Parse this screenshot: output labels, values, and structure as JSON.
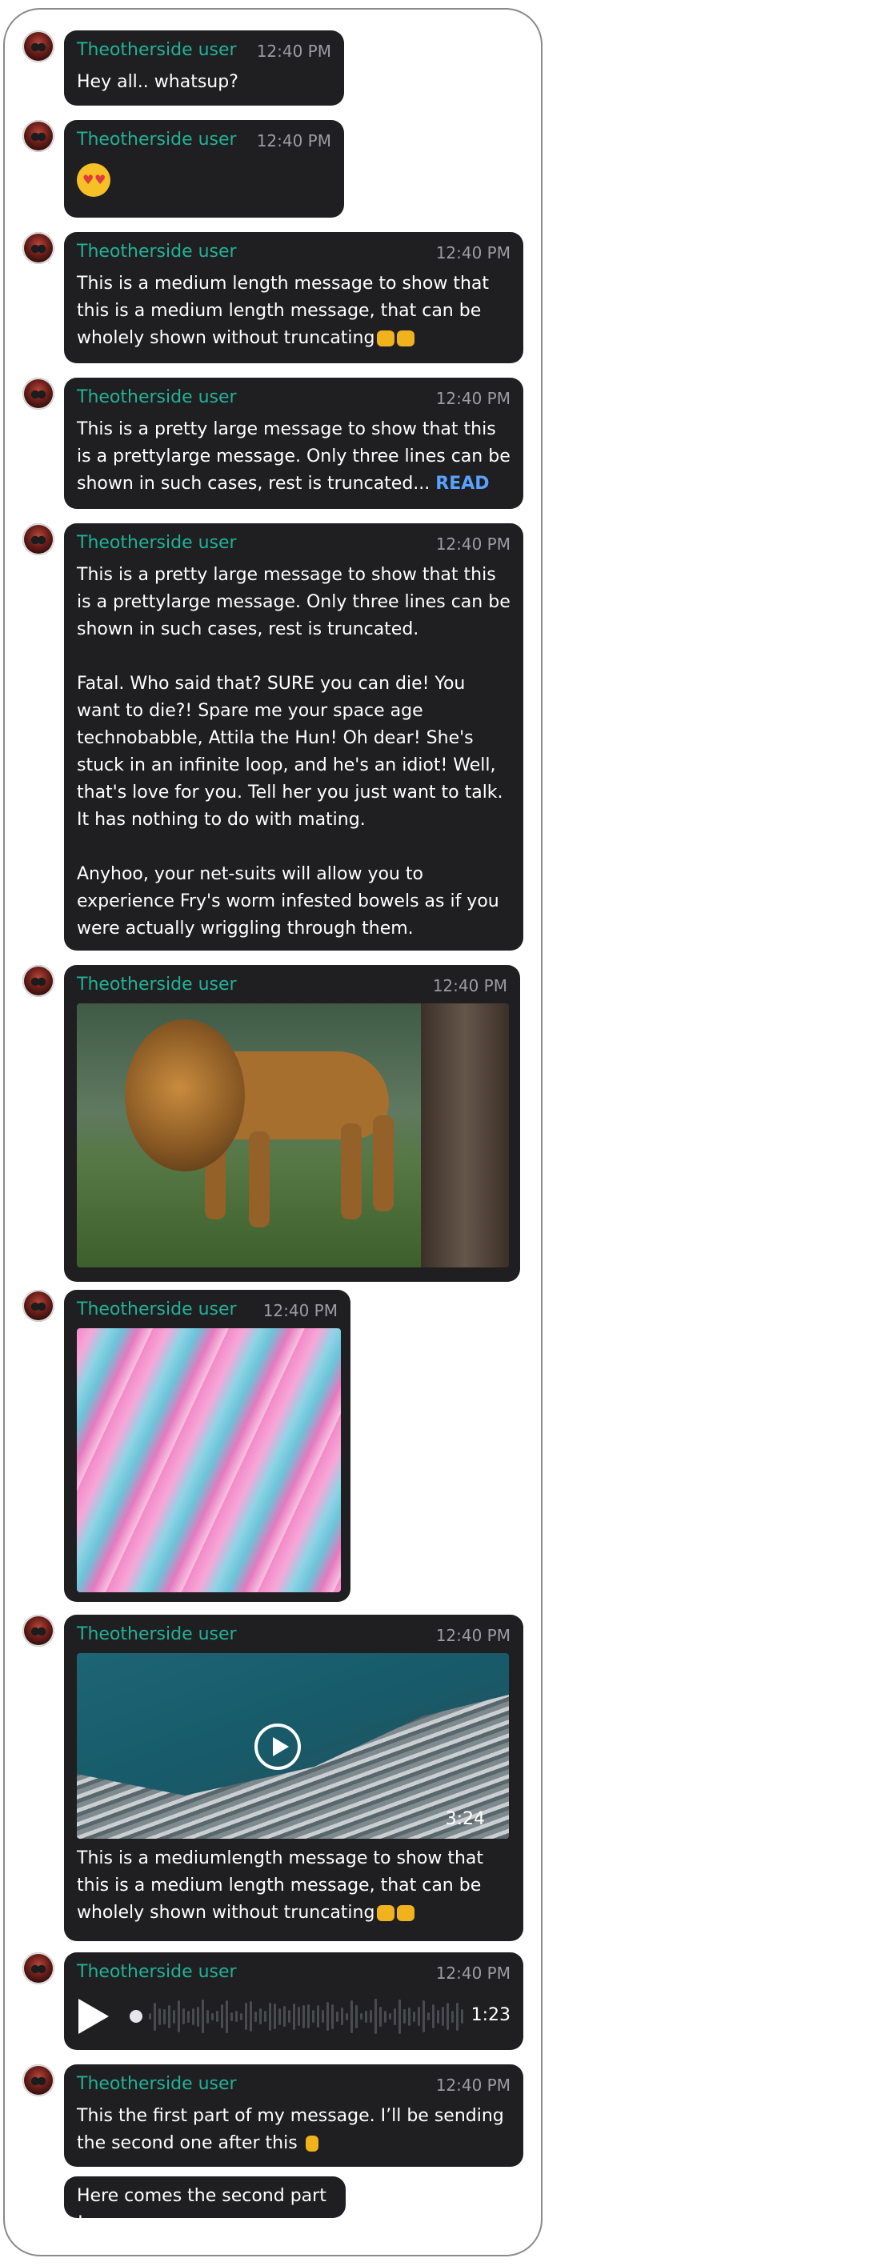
{
  "messages": [
    {
      "user": "Theotherside user",
      "time": "12:40 PM",
      "text": "Hey all.. whatsup?"
    },
    {
      "user": "Theotherside user",
      "time": "12:40 PM",
      "emoji": "heart-eyes-emoji"
    },
    {
      "user": "Theotherside user",
      "time": "12:40 PM",
      "text": "This is a medium length message to show that this is a medium length message, that can be wholely shown without truncating"
    },
    {
      "user": "Theotherside user",
      "time": "12:40 PM",
      "text": "This is a pretty large message to show that this is a prettylarge message. Only three lines can be shown in such cases, rest is truncated...",
      "read_more": "READ"
    },
    {
      "user": "Theotherside user",
      "time": "12:40 PM",
      "text_p1": "This is a pretty large message to show that this is a prettylarge message. Only three lines can be shown in such cases, rest is truncated.",
      "text_p2": "Fatal. Who said that? SURE you can die! You want to die?! Spare me your space age technobabble, Attila the Hun! Oh dear! She's stuck in an infinite loop, and he's an idiot! Well, that's love for you. Tell her you just want to talk. It has nothing to do with mating.",
      "text_p3": "Anyhoo, your net-suits will allow you to experience Fry's worm infested bowels as if you were actually wriggling through them."
    },
    {
      "user": "Theotherside user",
      "time": "12:40 PM",
      "image": "lion-photo"
    },
    {
      "user": "Theotherside user",
      "time": "12:40 PM",
      "image": "abstract-paint-photo"
    },
    {
      "user": "Theotherside user",
      "time": "12:40 PM",
      "video_duration": "3:24",
      "text": "This is a mediumlength message to show that this is a medium length message, that can be wholely shown without truncating"
    },
    {
      "user": "Theotherside user",
      "time": "12:40 PM",
      "audio_duration": "1:23"
    },
    {
      "user": "Theotherside user",
      "time": "12:40 PM",
      "text": "This the first part of my message. I’ll be sending the second one after this",
      "followup": "Here comes the second part !"
    }
  ],
  "colors": {
    "bubble": "#1f1f22",
    "username": "#22b197",
    "timestamp": "#9b9ba3",
    "link": "#5aa1ff"
  }
}
